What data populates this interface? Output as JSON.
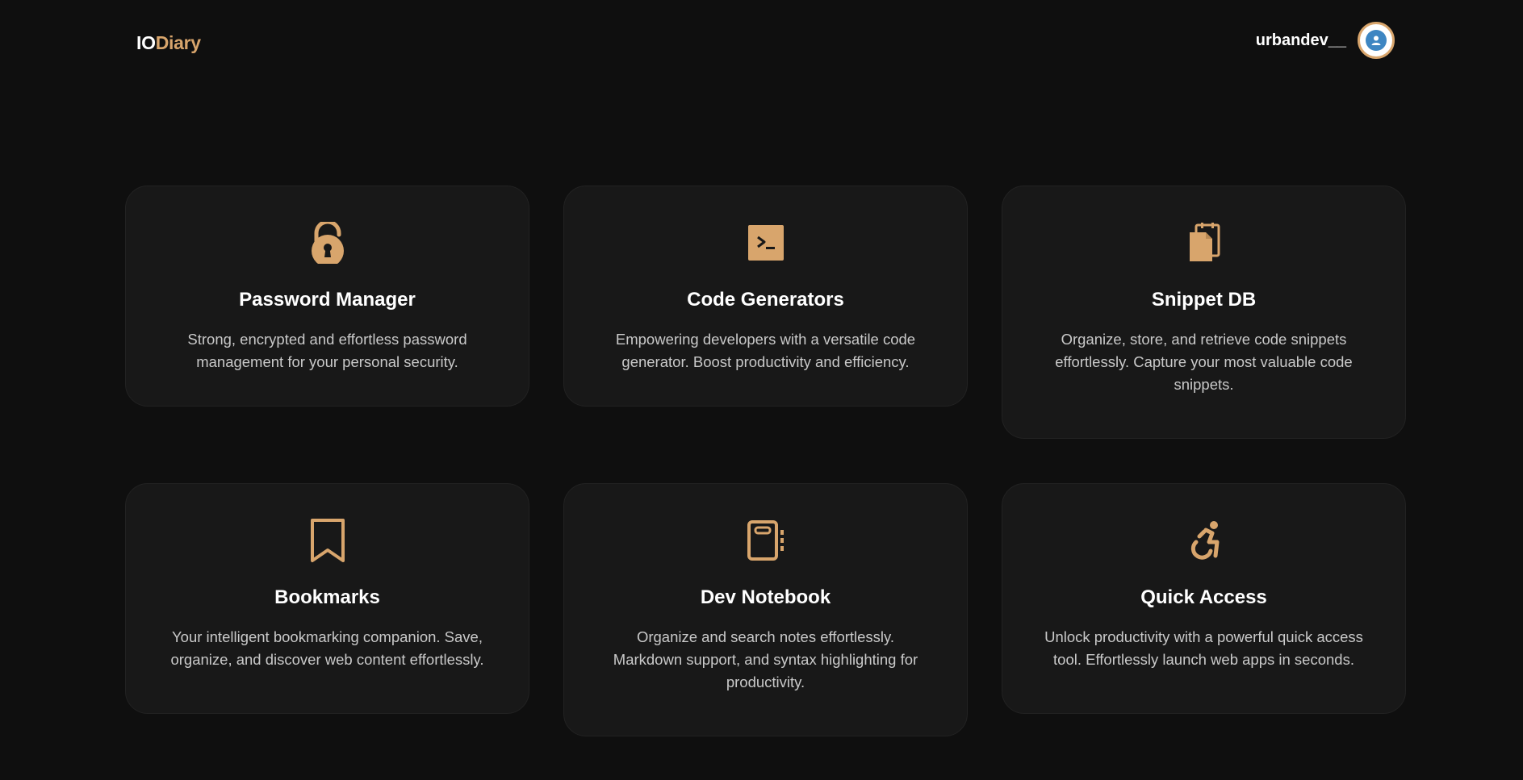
{
  "header": {
    "logo_part1": "IO",
    "logo_part2": "Diary",
    "username": "urbandev__"
  },
  "colors": {
    "accent": "#d8a56c",
    "background": "#0f0f0f",
    "card": "#181818",
    "avatar_blue": "#3e86c2"
  },
  "cards": [
    {
      "title": "Password Manager",
      "description": "Strong, encrypted and effortless password management for your personal security.",
      "icon": "unlocked-padlock-icon"
    },
    {
      "title": "Code Generators",
      "description": "Empowering developers with a versatile code generator. Boost productivity and efficiency.",
      "icon": "terminal-icon"
    },
    {
      "title": "Snippet DB",
      "description": "Organize, store, and retrieve code snippets effortlessly. Capture your most valuable code snippets.",
      "icon": "clipboard-file-icon"
    },
    {
      "title": "Bookmarks",
      "description": "Your intelligent bookmarking companion. Save, organize, and discover web content effortlessly.",
      "icon": "bookmark-icon"
    },
    {
      "title": "Dev Notebook",
      "description": "Organize and search notes effortlessly. Markdown support, and syntax highlighting for productivity.",
      "icon": "notebook-icon"
    },
    {
      "title": "Quick Access",
      "description": "Unlock productivity with a powerful quick access tool. Effortlessly launch web apps in seconds.",
      "icon": "accessibility-icon"
    }
  ]
}
